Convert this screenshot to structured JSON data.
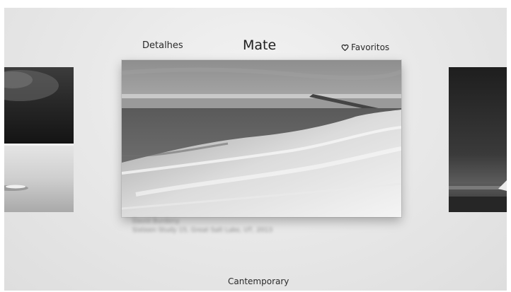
{
  "header": {
    "details_label": "Detalhes",
    "title": "Mate",
    "favorites_label": "Favoritos"
  },
  "artwork": {
    "artist_name": "David Burdeny",
    "caption": "Sixteen Study 15, Great Salt Lake, UT, 2013"
  },
  "footer": {
    "category": "Cantemporary"
  },
  "icons": {
    "favorites": "heart-outline-icon"
  },
  "colors": {
    "background": "#e9e9e9",
    "text": "#2a2a2a"
  }
}
